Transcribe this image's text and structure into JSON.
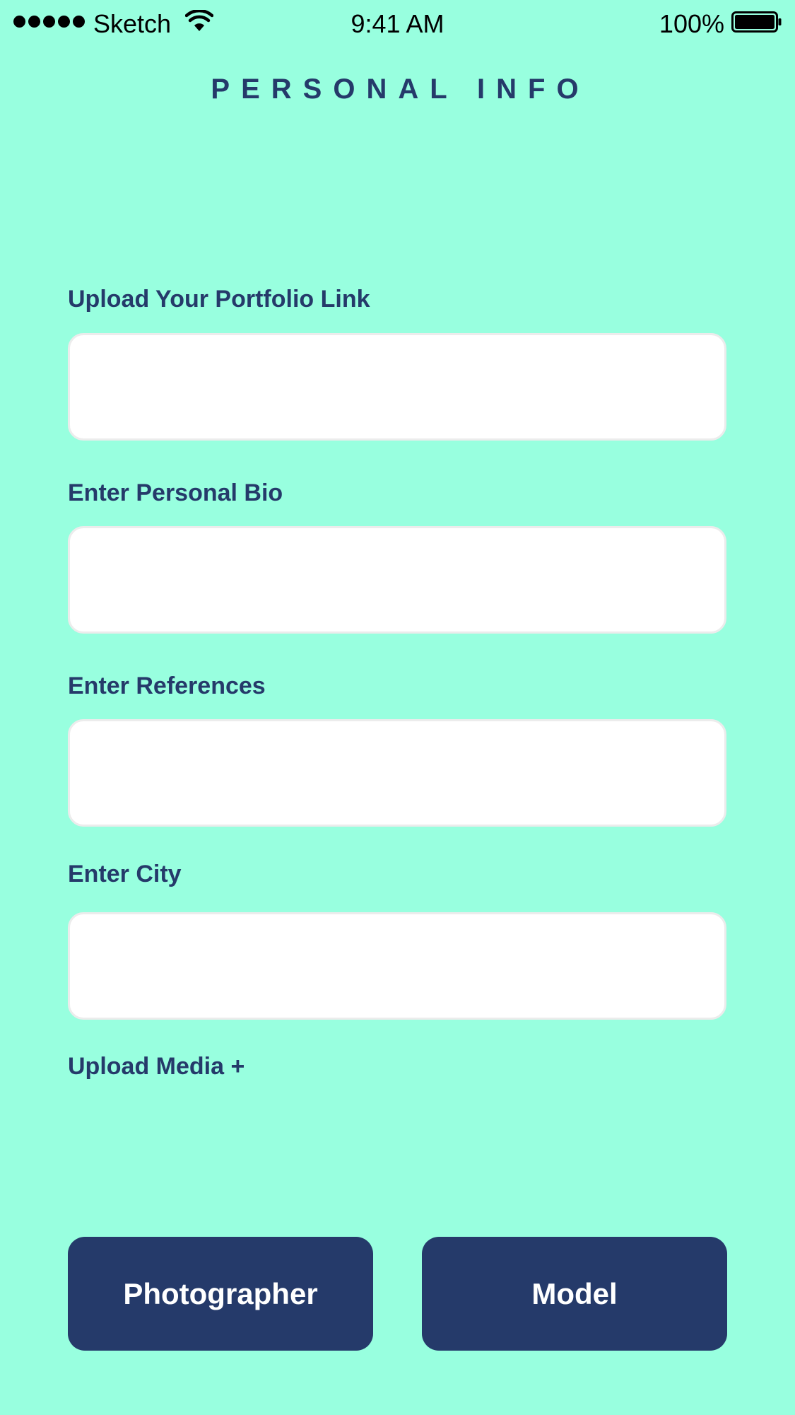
{
  "status_bar": {
    "carrier": "Sketch",
    "time": "9:41 AM",
    "battery_percent": "100%",
    "signal_dots": 5,
    "icons": [
      "signal-dots-icon",
      "wifi-icon",
      "battery-icon"
    ]
  },
  "page": {
    "title": "PERSONAL INFO"
  },
  "form": {
    "portfolio": {
      "label": "Upload Your Portfolio Link",
      "value": "",
      "placeholder": ""
    },
    "bio": {
      "label": "Enter Personal Bio",
      "value": "",
      "placeholder": ""
    },
    "references": {
      "label": "Enter References",
      "value": "",
      "placeholder": ""
    },
    "city": {
      "label": "Enter City",
      "value": "",
      "placeholder": ""
    },
    "upload_media_label": "Upload Media +"
  },
  "actions": {
    "photographer_label": "Photographer",
    "model_label": "Model"
  },
  "colors": {
    "background": "#98ffdf",
    "accent": "#253a6a",
    "input_background": "#ffffff",
    "input_border": "#ececec"
  }
}
